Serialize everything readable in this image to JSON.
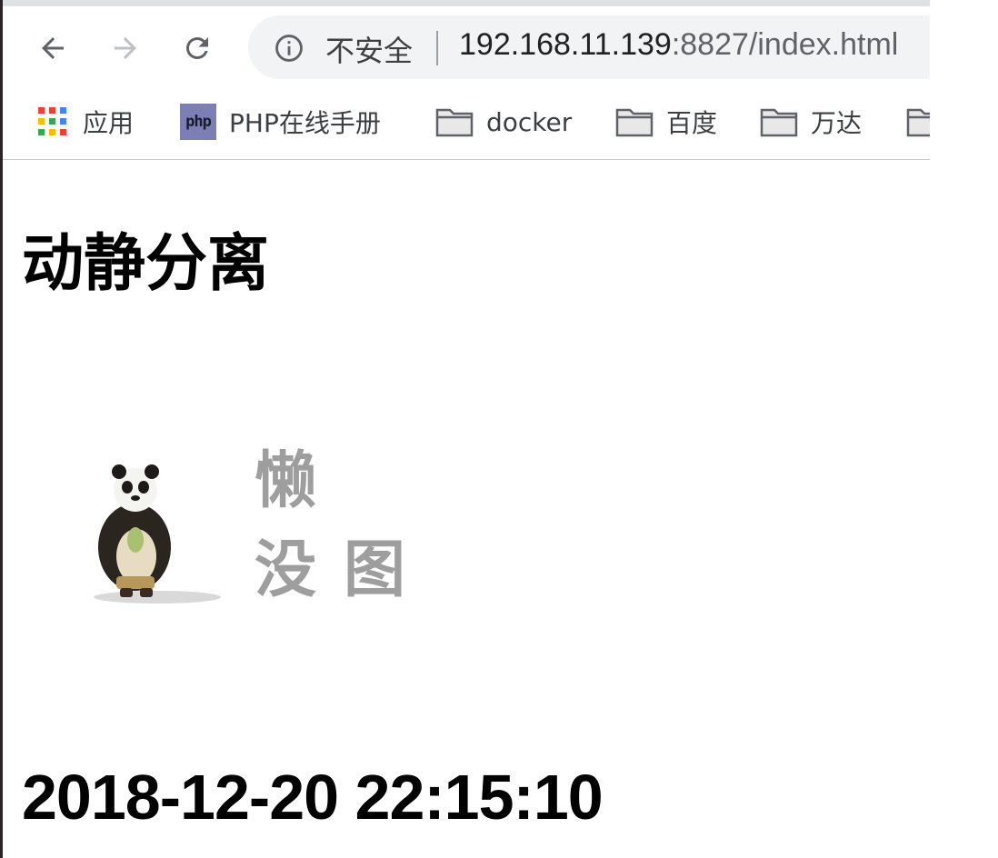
{
  "toolbar": {
    "back_icon": "arrow-left-icon",
    "forward_icon": "arrow-right-icon",
    "reload_icon": "reload-icon",
    "security_icon": "info-icon",
    "security_label": "不安全",
    "url_host": "192.168.11.139",
    "url_rest": ":8827/index.html"
  },
  "bookmarks": {
    "items": [
      {
        "label": "应用",
        "icon": "apps-grid-icon"
      },
      {
        "label": "PHP在线手册",
        "icon": "php-icon",
        "icon_text": "php"
      },
      {
        "label": "docker",
        "icon": "folder-icon"
      },
      {
        "label": "百度",
        "icon": "folder-icon"
      },
      {
        "label": "万达",
        "icon": "folder-icon"
      }
    ]
  },
  "page": {
    "heading": "动静分离",
    "placeholder_image": {
      "line1": "懒",
      "line2a": "没",
      "line2b": "图",
      "picture": "panda-icon"
    },
    "timestamp": "2018-12-20 22:15:10"
  },
  "colors": {
    "chrome_bg": "#ffffff",
    "omnibox_bg": "#f1f3f4",
    "placeholder_text": "#9e9e9e",
    "php_badge": "#7b7fb3"
  }
}
